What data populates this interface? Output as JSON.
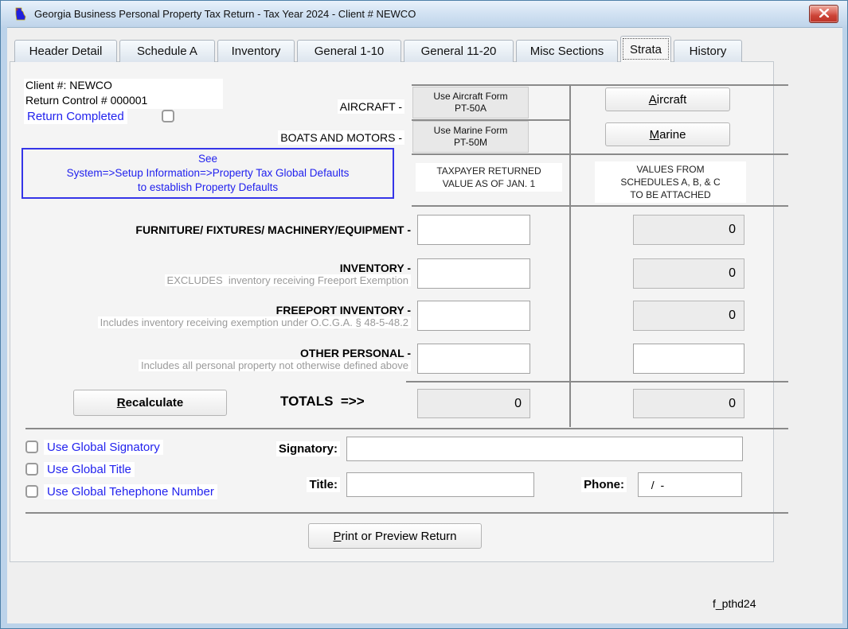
{
  "window": {
    "title": "Georgia Business Personal Property Tax Return - Tax Year 2024 - Client # NEWCO",
    "form_id": "f_pthd24"
  },
  "tabs": {
    "items": [
      {
        "label": "Header Detail"
      },
      {
        "label": "Schedule A"
      },
      {
        "label": "Inventory"
      },
      {
        "label": "General 1-10"
      },
      {
        "label": "General 11-20"
      },
      {
        "label": "Misc Sections"
      },
      {
        "label": "Strata"
      },
      {
        "label": "History"
      }
    ],
    "active": "Strata"
  },
  "client": {
    "client_number": "Client #: NEWCO",
    "return_control": "Return Control # 000001",
    "completed_label": "Return Completed",
    "completed_checked": false
  },
  "vehicles": {
    "aircraft_label": "AIRCRAFT -",
    "aircraft_info": "Use Aircraft Form\nPT-50A",
    "aircraft_button": {
      "accel": "A",
      "rest": "ircraft"
    },
    "boats_label": "BOATS AND MOTORS -",
    "marine_info": "Use Marine Form\nPT-50M",
    "marine_button": {
      "accel": "M",
      "rest": "arine"
    }
  },
  "defaults_note": "See\nSystem=>Setup Information=>Property Tax Global Defaults\nto establish Property Defaults",
  "table": {
    "left_header": "TAXPAYER RETURNED\nVALUE AS OF JAN. 1",
    "right_header": "VALUES FROM\nSCHEDULES A, B, & C\nTO BE ATTACHED",
    "rows": [
      {
        "label": "FURNITURE/ FIXTURES/ MACHINERY/EQUIPMENT -",
        "sub": "",
        "input_value": "",
        "schedule_value": "0"
      },
      {
        "label": "INVENTORY -",
        "sub": "EXCLUDES  inventory receiving Freeport Exemption",
        "input_value": "",
        "schedule_value": "0"
      },
      {
        "label": "FREEPORT INVENTORY -",
        "sub": "Includes inventory receiving exemption under O.C.G.A. § 48-5-48.2",
        "input_value": "",
        "schedule_value": "0"
      },
      {
        "label": "OTHER PERSONAL -",
        "sub": "Includes all personal property not otherwise defined above",
        "input_value": "",
        "other_value": ""
      }
    ],
    "totals": {
      "recalculate_button": {
        "accel": "R",
        "rest": "ecalculate"
      },
      "label": "TOTALS  =>>",
      "taxpayer_total": "0",
      "schedule_total": "0"
    }
  },
  "signature": {
    "checkboxes": [
      {
        "label": "Use Global Signatory",
        "checked": false
      },
      {
        "label": "Use Global Title",
        "checked": false
      },
      {
        "label": "Use Global Tehephone Number",
        "checked": false
      }
    ],
    "signatory_label": "Signatory:",
    "signatory_value": "",
    "title_label": "Title:",
    "title_value": "",
    "phone_label": "Phone:",
    "phone_value": "  /  -"
  },
  "footer": {
    "print_button": {
      "accel": "P",
      "rest": "rint or Preview Return"
    }
  }
}
